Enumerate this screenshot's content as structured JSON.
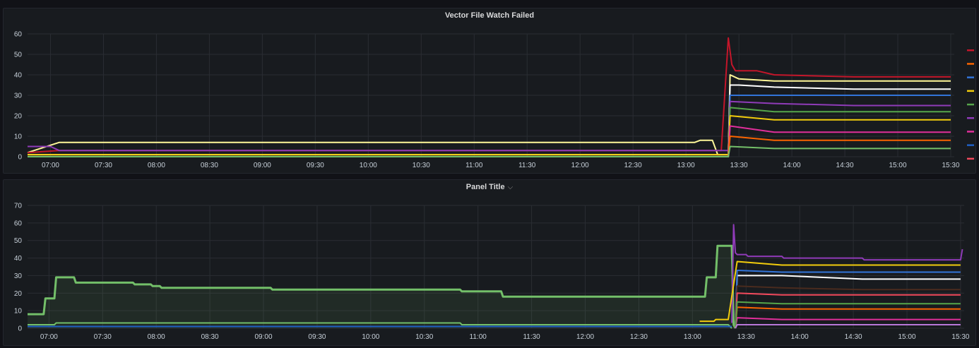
{
  "panels": [
    {
      "title": "Vector File Watch Failed",
      "has_menu": false
    },
    {
      "title": "Panel Title",
      "has_menu": true,
      "menu_icon": "chevron-down-icon"
    }
  ],
  "chart_data": [
    {
      "type": "line",
      "title": "Vector File Watch Failed",
      "xlabel": "",
      "ylabel": "",
      "x_ticks": [
        "07:00",
        "07:30",
        "08:00",
        "08:30",
        "09:00",
        "09:30",
        "10:00",
        "10:30",
        "11:00",
        "11:30",
        "12:00",
        "12:30",
        "13:00",
        "13:30",
        "14:00",
        "14:30",
        "15:00",
        "15:30"
      ],
      "y_ticks": [
        0,
        10,
        20,
        30,
        40,
        50,
        60
      ],
      "ylim": [
        0,
        60
      ],
      "xlim": [
        "06:47",
        "15:32"
      ],
      "grid": true,
      "legend": {
        "position": "right",
        "entries_visible": 9,
        "colors": [
          "#c4162a",
          "#fa6400",
          "#3274d9",
          "#f2cc0c",
          "#56a64b",
          "#8f3bb8",
          "#e02f9a",
          "#1f60c4",
          "#f2495c"
        ]
      },
      "series": [
        {
          "color": "#fff899",
          "values": [
            [
              "06:47",
              2
            ],
            [
              "07:05",
              7
            ],
            [
              "13:05",
              7
            ],
            [
              "13:08",
              8
            ],
            [
              "13:15",
              8
            ],
            [
              "13:18",
              1
            ],
            [
              "13:24",
              1
            ],
            [
              "13:25",
              40
            ],
            [
              "13:30",
              38
            ],
            [
              "13:50",
              37
            ],
            [
              "14:35",
              37
            ],
            [
              "15:30",
              37
            ]
          ]
        },
        {
          "color": "#c4162a",
          "values": [
            [
              "06:47",
              2
            ],
            [
              "07:05",
              3
            ],
            [
              "13:20",
              3
            ],
            [
              "13:24",
              58
            ],
            [
              "13:26",
              45
            ],
            [
              "13:28",
              42
            ],
            [
              "13:40",
              42
            ],
            [
              "13:50",
              40
            ],
            [
              "14:35",
              39
            ],
            [
              "15:30",
              39
            ]
          ]
        },
        {
          "color": "#ffffff",
          "values": [
            [
              "06:47",
              1
            ],
            [
              "13:24",
              1
            ],
            [
              "13:25",
              35
            ],
            [
              "13:30",
              35
            ],
            [
              "13:50",
              34
            ],
            [
              "14:35",
              33
            ],
            [
              "15:30",
              33
            ]
          ]
        },
        {
          "color": "#3274d9",
          "values": [
            [
              "06:47",
              0
            ],
            [
              "13:24",
              0
            ],
            [
              "13:25",
              30
            ],
            [
              "13:50",
              30
            ],
            [
              "14:35",
              30
            ],
            [
              "15:30",
              30
            ]
          ]
        },
        {
          "color": "#8f3bb8",
          "values": [
            [
              "06:47",
              5
            ],
            [
              "07:00",
              5
            ],
            [
              "07:05",
              3
            ],
            [
              "13:24",
              3
            ],
            [
              "13:25",
              27
            ],
            [
              "13:50",
              26
            ],
            [
              "14:35",
              25
            ],
            [
              "15:30",
              25
            ]
          ]
        },
        {
          "color": "#56a64b",
          "values": [
            [
              "06:47",
              0
            ],
            [
              "13:24",
              0
            ],
            [
              "13:25",
              24
            ],
            [
              "13:50",
              22
            ],
            [
              "14:35",
              22
            ],
            [
              "15:30",
              22
            ]
          ]
        },
        {
          "color": "#f2cc0c",
          "values": [
            [
              "06:47",
              1
            ],
            [
              "13:24",
              1
            ],
            [
              "13:25",
              20
            ],
            [
              "13:50",
              18
            ],
            [
              "14:35",
              18
            ],
            [
              "15:30",
              18
            ]
          ]
        },
        {
          "color": "#e02f9a",
          "values": [
            [
              "06:47",
              0
            ],
            [
              "13:24",
              0
            ],
            [
              "13:25",
              15
            ],
            [
              "13:50",
              12
            ],
            [
              "14:35",
              12
            ],
            [
              "15:30",
              12
            ]
          ]
        },
        {
          "color": "#fa6400",
          "values": [
            [
              "06:47",
              0
            ],
            [
              "13:24",
              0
            ],
            [
              "13:25",
              10
            ],
            [
              "13:50",
              8
            ],
            [
              "14:35",
              8
            ],
            [
              "15:30",
              8
            ]
          ]
        },
        {
          "color": "#73bf69",
          "values": [
            [
              "06:47",
              0
            ],
            [
              "13:24",
              0
            ],
            [
              "13:25",
              5
            ],
            [
              "13:50",
              4
            ],
            [
              "14:35",
              4
            ],
            [
              "15:30",
              4
            ]
          ]
        }
      ]
    },
    {
      "type": "line",
      "title": "Panel Title",
      "xlabel": "",
      "ylabel": "",
      "x_ticks": [
        "07:00",
        "07:30",
        "08:00",
        "08:30",
        "09:00",
        "09:30",
        "10:00",
        "10:30",
        "11:00",
        "11:30",
        "12:00",
        "12:30",
        "13:00",
        "13:30",
        "14:00",
        "14:30",
        "15:00",
        "15:30"
      ],
      "y_ticks": [
        0,
        10,
        20,
        30,
        40,
        50,
        60,
        70
      ],
      "ylim": [
        0,
        70
      ],
      "xlim": [
        "06:48",
        "15:32"
      ],
      "grid": true,
      "legend": null,
      "series": [
        {
          "color": "#73bf69",
          "fill": true,
          "values": [
            [
              "06:48",
              8
            ],
            [
              "06:57",
              8
            ],
            [
              "06:58",
              17
            ],
            [
              "07:03",
              17
            ],
            [
              "07:04",
              29
            ],
            [
              "07:14",
              29
            ],
            [
              "07:15",
              26
            ],
            [
              "07:47",
              26
            ],
            [
              "07:48",
              25
            ],
            [
              "07:57",
              25
            ],
            [
              "07:58",
              24
            ],
            [
              "08:02",
              24
            ],
            [
              "08:03",
              23
            ],
            [
              "09:04",
              23
            ],
            [
              "09:05",
              22
            ],
            [
              "10:50",
              22
            ],
            [
              "10:51",
              21
            ],
            [
              "11:13",
              21
            ],
            [
              "11:14",
              18
            ],
            [
              "13:07",
              18
            ],
            [
              "13:08",
              29
            ],
            [
              "13:13",
              29
            ],
            [
              "13:14",
              47
            ],
            [
              "13:22",
              47
            ],
            [
              "13:23",
              2
            ],
            [
              "13:24",
              0
            ]
          ]
        },
        {
          "color": "#73bf69",
          "values": [
            [
              "06:48",
              2
            ],
            [
              "07:03",
              2
            ],
            [
              "07:04",
              3
            ],
            [
              "10:50",
              3
            ],
            [
              "10:51",
              2
            ],
            [
              "13:20",
              2
            ],
            [
              "13:22",
              0
            ]
          ]
        },
        {
          "color": "#1f60c4",
          "values": [
            [
              "06:48",
              1
            ],
            [
              "13:22",
              1
            ]
          ]
        },
        {
          "color": "#8f3bb8",
          "values": [
            [
              "13:22",
              3
            ],
            [
              "13:23",
              59
            ],
            [
              "13:24",
              43
            ],
            [
              "13:25",
              42
            ],
            [
              "13:30",
              42
            ],
            [
              "13:31",
              41
            ],
            [
              "13:50",
              41
            ],
            [
              "13:51",
              40
            ],
            [
              "14:35",
              40
            ],
            [
              "14:36",
              39
            ],
            [
              "15:30",
              39
            ],
            [
              "15:31",
              45
            ]
          ]
        },
        {
          "color": "#f2cc0c",
          "values": [
            [
              "13:04",
              4
            ],
            [
              "13:12",
              4
            ],
            [
              "13:13",
              5
            ],
            [
              "13:20",
              5
            ],
            [
              "13:25",
              38
            ],
            [
              "13:50",
              36
            ],
            [
              "15:30",
              36
            ]
          ]
        },
        {
          "color": "#ffffff",
          "values": [
            [
              "13:24",
              0
            ],
            [
              "13:25",
              30
            ],
            [
              "13:50",
              30
            ],
            [
              "14:35",
              28
            ],
            [
              "15:30",
              28
            ]
          ]
        },
        {
          "color": "#3274d9",
          "values": [
            [
              "13:24",
              0
            ],
            [
              "13:25",
              33
            ],
            [
              "13:50",
              32
            ],
            [
              "15:30",
              32
            ]
          ]
        },
        {
          "color": "#4a2b1e",
          "values": [
            [
              "13:24",
              0
            ],
            [
              "13:25",
              24
            ],
            [
              "13:50",
              23
            ],
            [
              "14:35",
              22
            ],
            [
              "15:30",
              22
            ]
          ]
        },
        {
          "color": "#f2495c",
          "values": [
            [
              "13:24",
              0
            ],
            [
              "13:25",
              20
            ],
            [
              "13:50",
              19
            ],
            [
              "15:30",
              19
            ]
          ]
        },
        {
          "color": "#fa6400",
          "values": [
            [
              "13:24",
              0
            ],
            [
              "13:25",
              12
            ],
            [
              "13:50",
              11
            ],
            [
              "15:30",
              11
            ]
          ]
        },
        {
          "color": "#e02f9a",
          "values": [
            [
              "13:24",
              0
            ],
            [
              "13:25",
              6
            ],
            [
              "13:50",
              5
            ],
            [
              "15:30",
              5
            ]
          ]
        },
        {
          "color": "#56a64b",
          "values": [
            [
              "13:24",
              0
            ],
            [
              "13:25",
              15
            ],
            [
              "13:50",
              14
            ],
            [
              "15:30",
              14
            ]
          ]
        },
        {
          "color": "#b877d9",
          "values": [
            [
              "13:24",
              0
            ],
            [
              "13:25",
              2
            ],
            [
              "15:30",
              2
            ]
          ]
        }
      ]
    }
  ]
}
